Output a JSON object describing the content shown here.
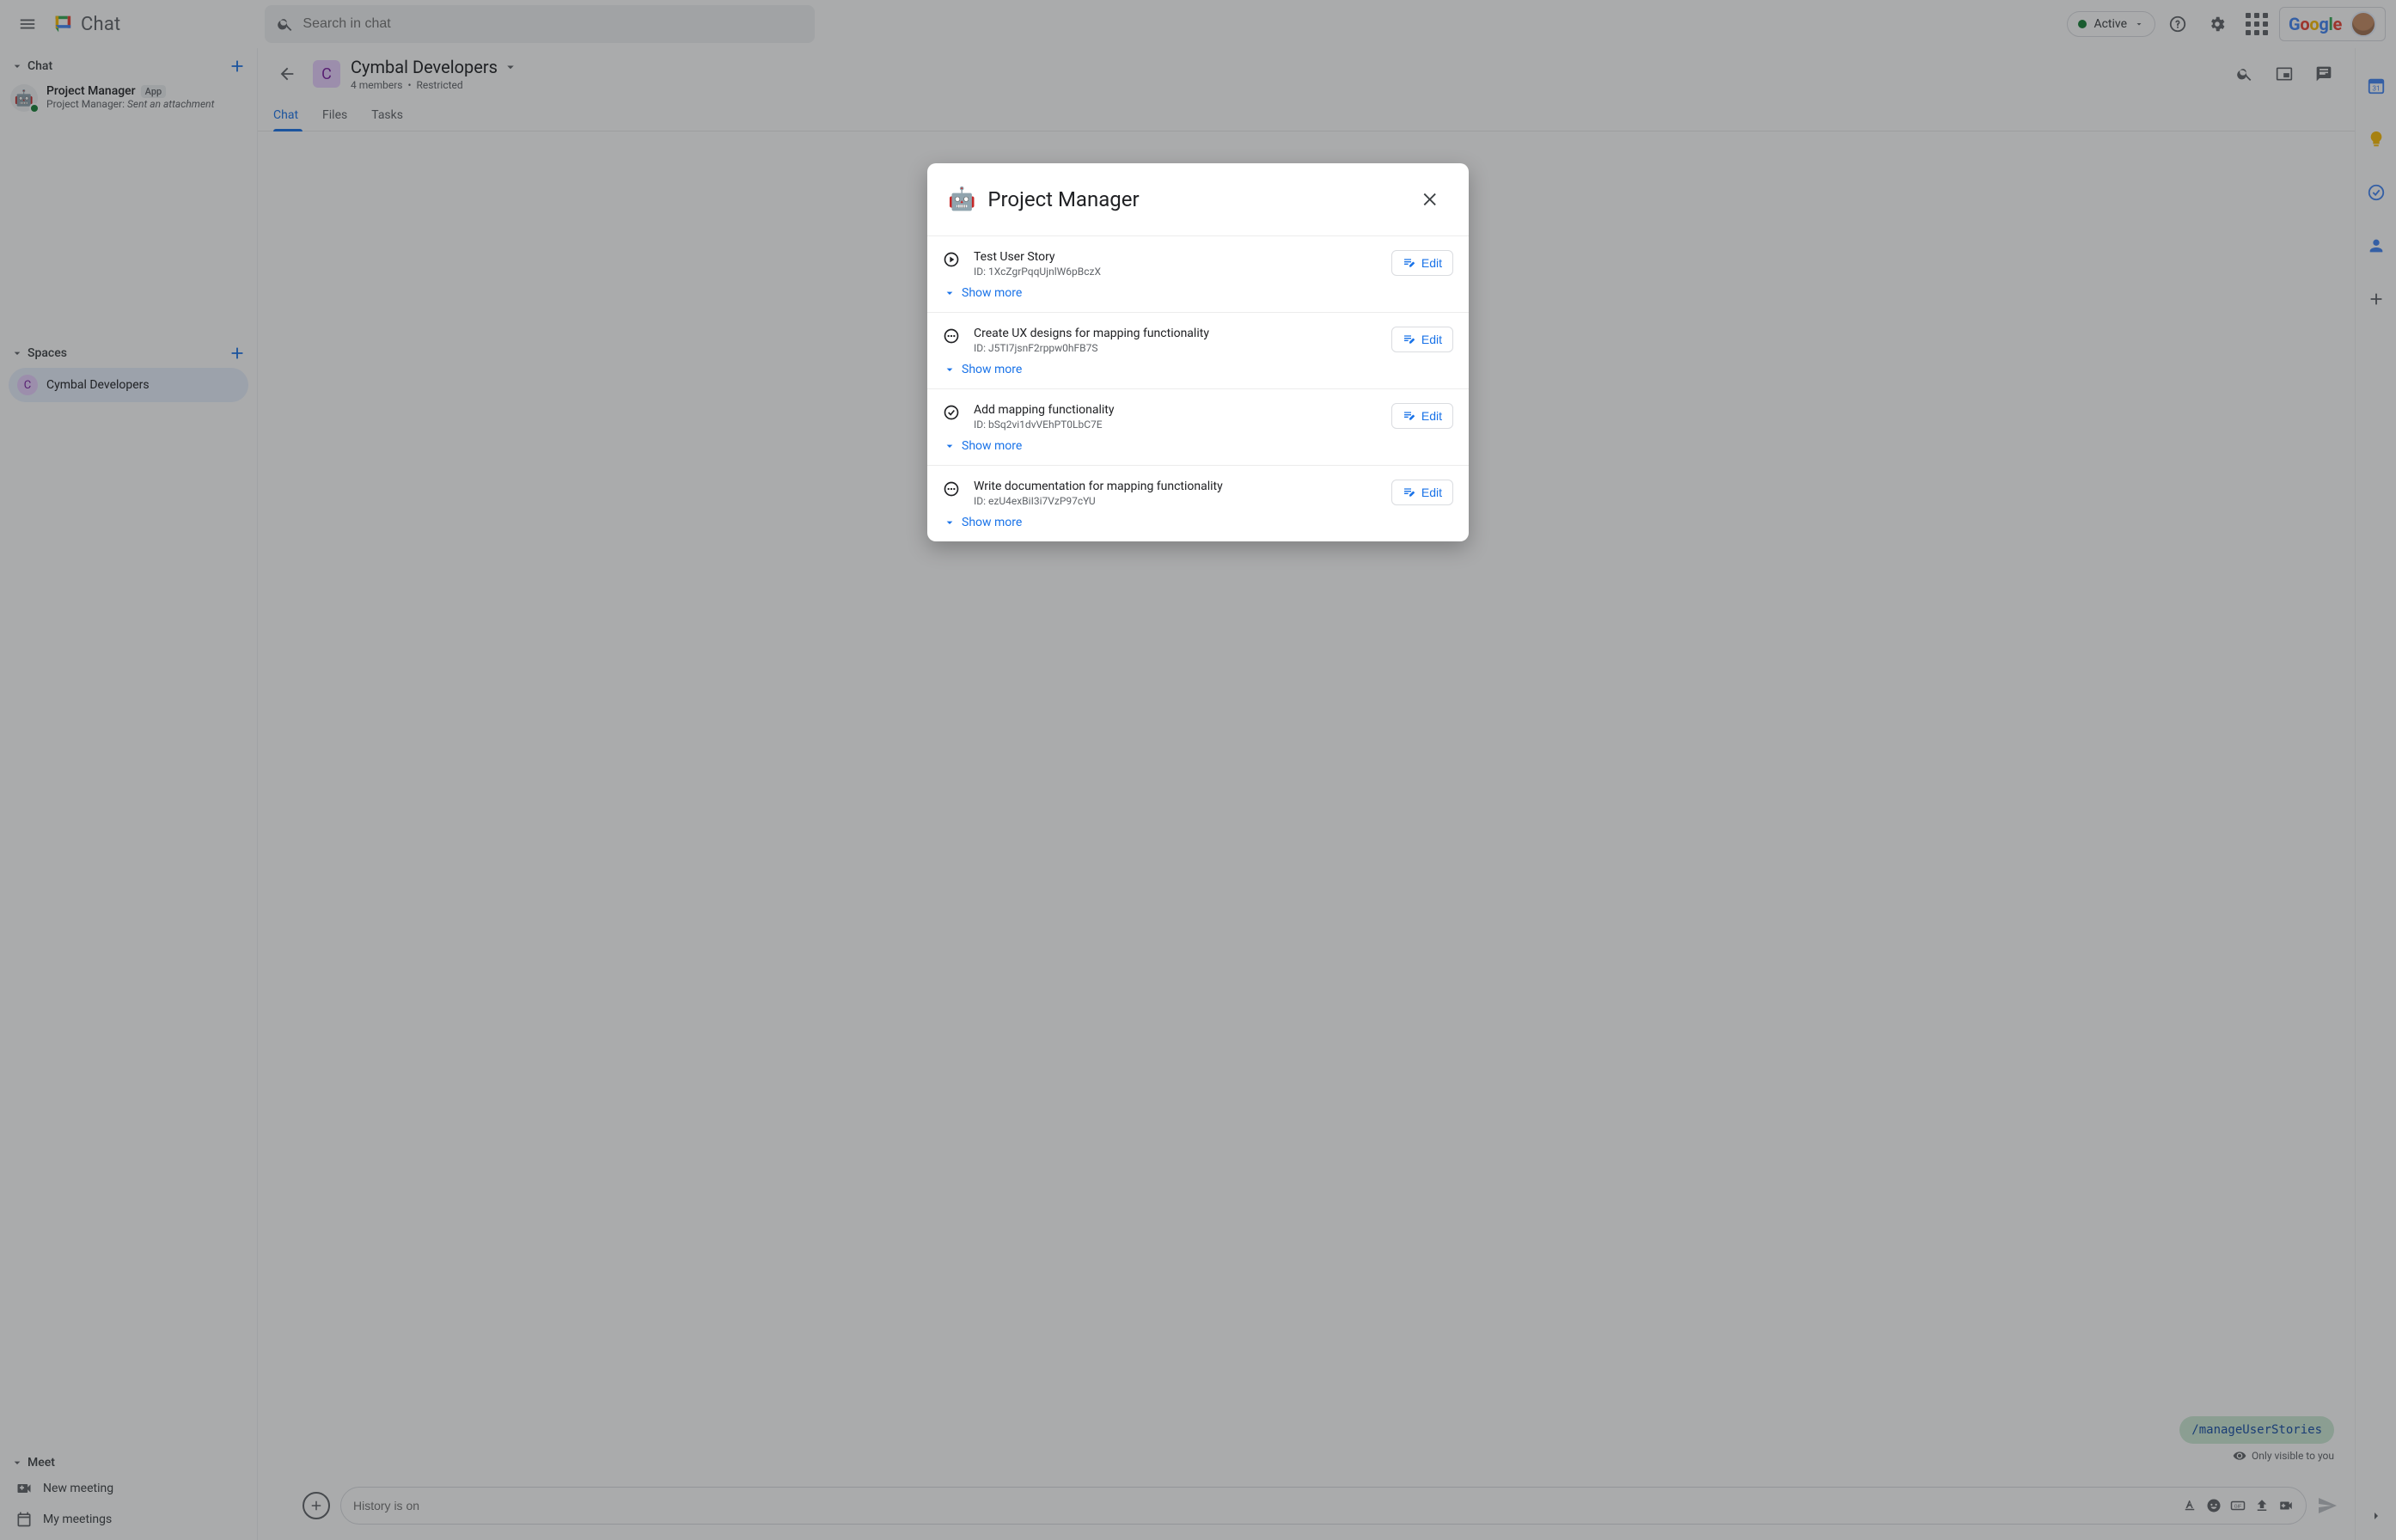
{
  "header": {
    "app_name": "Chat",
    "search_placeholder": "Search in chat",
    "status_label": "Active",
    "google_word": "Google"
  },
  "sidebar": {
    "chat_section": "Chat",
    "chat_items": [
      {
        "title": "Project Manager",
        "badge": "App",
        "sub_prefix": "Project Manager:",
        "sub_italic": "Sent an attachment"
      }
    ],
    "spaces_section": "Spaces",
    "spaces": [
      {
        "initial": "C",
        "name": "Cymbal Developers"
      }
    ],
    "meet_section": "Meet",
    "meet_items": {
      "new_meeting": "New meeting",
      "my_meetings": "My meetings"
    }
  },
  "conversation": {
    "space_initial": "C",
    "title": "Cymbal Developers",
    "members": "4 members",
    "restriction": "Restricted",
    "tabs": {
      "chat": "Chat",
      "files": "Files",
      "tasks": "Tasks"
    },
    "command_chip": "/manageUserStories",
    "visibility_note": "Only visible to you",
    "compose_placeholder": "History is on"
  },
  "modal": {
    "title": "Project Manager",
    "show_more": "Show more",
    "edit": "Edit",
    "stories": [
      {
        "status": "play",
        "title": "Test User Story",
        "id": "ID: 1XcZgrPqqUjnlW6pBczX"
      },
      {
        "status": "pending",
        "title": "Create UX designs for mapping functionality",
        "id": "ID: J5TI7jsnF2rppw0hFB7S"
      },
      {
        "status": "done",
        "title": "Add mapping functionality",
        "id": "ID: bSq2vi1dvVEhPT0LbC7E"
      },
      {
        "status": "pending",
        "title": "Write documentation for mapping functionality",
        "id": "ID: ezU4exBiI3i7VzP97cYU"
      }
    ]
  }
}
